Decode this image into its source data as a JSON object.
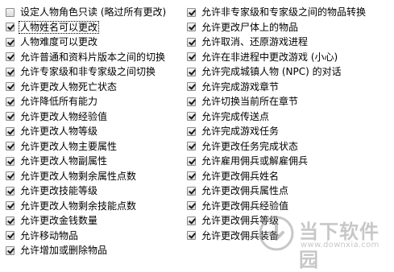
{
  "options_left": [
    {
      "label": "设定人物角色只读 (略过所有更改)",
      "checked": false,
      "focused": false
    },
    {
      "label": "人物姓名可以更改",
      "checked": true,
      "focused": true
    },
    {
      "label": "人物难度可以更改",
      "checked": true,
      "focused": false
    },
    {
      "label": "允许普通和资料片版本之间的切换",
      "checked": true,
      "focused": false
    },
    {
      "label": "允许专家级和非专家级之间切换",
      "checked": true,
      "focused": false
    },
    {
      "label": "允许更改人物死亡状态",
      "checked": true,
      "focused": false
    },
    {
      "label": "允许降低所有能力",
      "checked": true,
      "focused": false
    },
    {
      "label": "允许更改人物经验值",
      "checked": true,
      "focused": false
    },
    {
      "label": "允许更改人物等级",
      "checked": true,
      "focused": false
    },
    {
      "label": "允许更改人物主要属性",
      "checked": true,
      "focused": false
    },
    {
      "label": "允许更改人物副属性",
      "checked": true,
      "focused": false
    },
    {
      "label": "允许更改人物剩余属性点数",
      "checked": true,
      "focused": false
    },
    {
      "label": "允许更改技能等级",
      "checked": true,
      "focused": false
    },
    {
      "label": "允许更改人物剩余技能点数",
      "checked": true,
      "focused": false
    },
    {
      "label": "允许更改金钱数量",
      "checked": true,
      "focused": false
    },
    {
      "label": "允许移动物品",
      "checked": true,
      "focused": false
    },
    {
      "label": "允许增加或删除物品",
      "checked": true,
      "focused": false
    }
  ],
  "options_right": [
    {
      "label": "允许非专家级和专家级之间的物品转换",
      "checked": true,
      "focused": false
    },
    {
      "label": "允许更改尸体上的物品",
      "checked": true,
      "focused": false
    },
    {
      "label": "允许取消、还原游戏进程",
      "checked": true,
      "focused": false
    },
    {
      "label": "允许在非进程中更改游戏 (小心)",
      "checked": true,
      "focused": false
    },
    {
      "label": "允许完成城镇人物 (NPC) 的对话",
      "checked": true,
      "focused": false
    },
    {
      "label": "允许完成游戏章节",
      "checked": true,
      "focused": false
    },
    {
      "label": "允许切换当前所在章节",
      "checked": true,
      "focused": false
    },
    {
      "label": "允许完成传送点",
      "checked": true,
      "focused": false
    },
    {
      "label": "允许完成游戏任务",
      "checked": true,
      "focused": false
    },
    {
      "label": "允许更改任务完成状态",
      "checked": true,
      "focused": false
    },
    {
      "label": "允许雇用佣兵或解雇佣兵",
      "checked": true,
      "focused": false
    },
    {
      "label": "允许更改佣兵姓名",
      "checked": true,
      "focused": false
    },
    {
      "label": "允许更改佣兵属性点",
      "checked": true,
      "focused": false
    },
    {
      "label": "允许更改佣兵经验值",
      "checked": true,
      "focused": false
    },
    {
      "label": "允许更改佣兵等级",
      "checked": true,
      "focused": false
    },
    {
      "label": "允许更改佣兵装备",
      "checked": true,
      "focused": false
    }
  ],
  "watermark": {
    "title": "当下软件园",
    "url": "www.downxia.com",
    "logo_icon": "download-logo-icon"
  }
}
